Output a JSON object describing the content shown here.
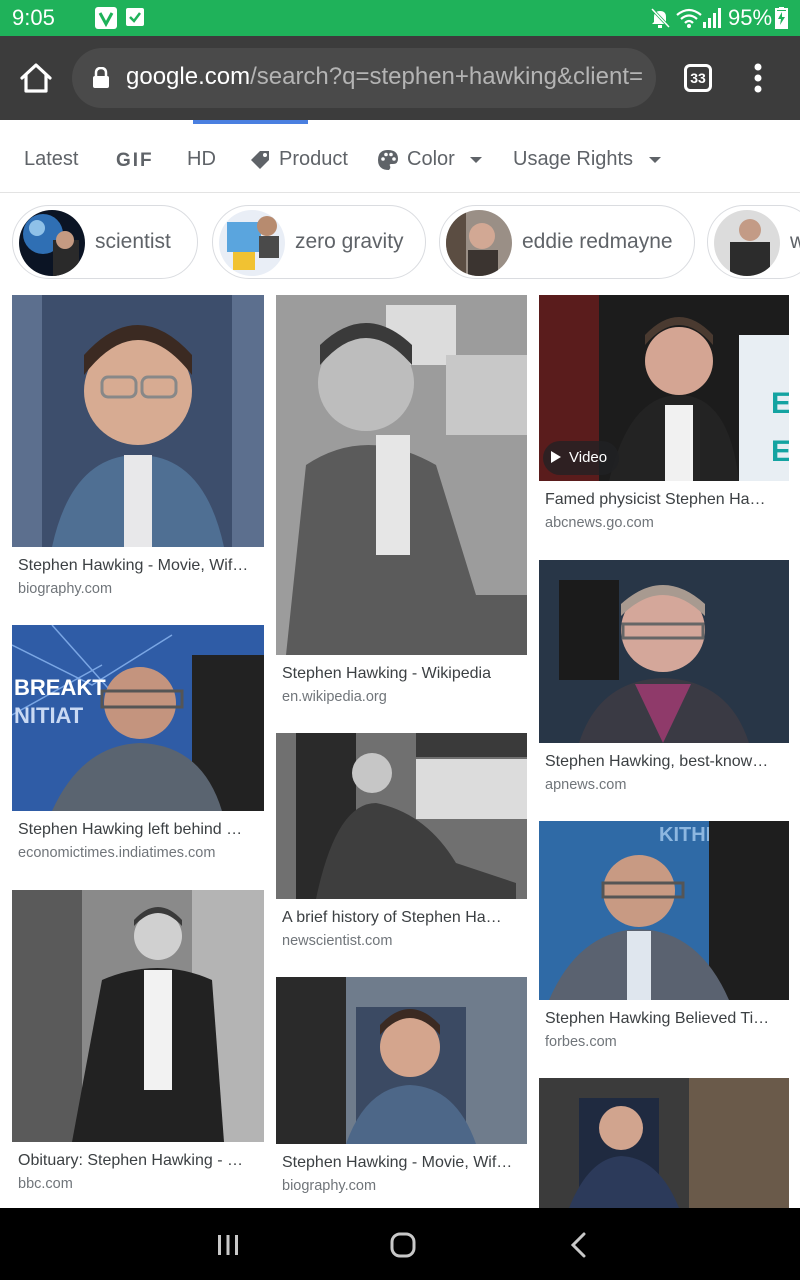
{
  "status_bar": {
    "time": "9:05",
    "battery": "95%",
    "colors": {
      "background": "#1fb25a"
    },
    "icons": [
      "vivino-notification-icon",
      "check-notification-icon",
      "mute-icon",
      "wifi-icon",
      "signal-icon",
      "battery-charging-icon"
    ]
  },
  "browser": {
    "home_icon": "home-icon",
    "lock_icon": "lock-icon",
    "url_domain": "google.com",
    "url_path": "/search?q=stephen+hawking&client=",
    "tab_count": "33",
    "menu_icon": "more-vert-icon"
  },
  "filters": [
    {
      "label": "Latest",
      "icon": null
    },
    {
      "label": "GIF",
      "icon": null
    },
    {
      "label": "HD",
      "icon": null
    },
    {
      "label": "Product",
      "icon": "tag-icon"
    },
    {
      "label": "Color",
      "icon": "palette-icon",
      "dropdown": true
    },
    {
      "label": "Usage Rights",
      "icon": null,
      "dropdown": true
    }
  ],
  "chips": [
    {
      "label": "scientist"
    },
    {
      "label": "zero gravity"
    },
    {
      "label": "eddie redmayne"
    },
    {
      "label": "w"
    }
  ],
  "results": [
    {
      "caption": "Stephen Hawking - Movie, Wif…",
      "source": "biography.com"
    },
    {
      "caption": "Stephen Hawking left behind …",
      "source": "economictimes.indiatimes.com"
    },
    {
      "caption": "Obituary: Stephen Hawking - …",
      "source": "bbc.com"
    },
    {
      "caption": "Stephen Hawking - Wikipedia",
      "source": "en.wikipedia.org"
    },
    {
      "caption": "A brief history of Stephen Ha…",
      "source": "newscientist.com"
    },
    {
      "caption": "Stephen Hawking - Movie, Wif…",
      "source": "biography.com"
    },
    {
      "caption": "Famed physicist Stephen Ha…",
      "source": "abcnews.go.com",
      "badge": "Video"
    },
    {
      "caption": "Stephen Hawking, best-know…",
      "source": "apnews.com"
    },
    {
      "caption": "Stephen Hawking Believed Ti…",
      "source": "forbes.com"
    },
    {
      "caption": "",
      "source": ""
    }
  ],
  "nav_bar": {
    "icons": [
      "recents-icon",
      "home-nav-icon",
      "back-icon"
    ]
  }
}
